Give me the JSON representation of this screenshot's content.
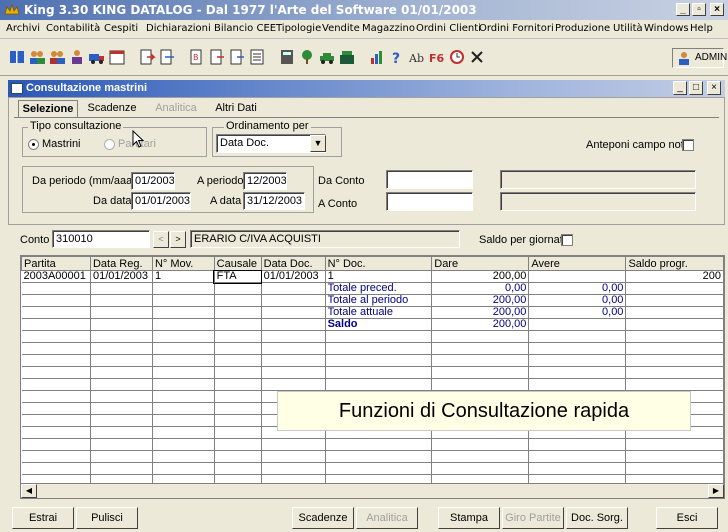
{
  "window": {
    "title": "King 3.30   KING   DATALOG - Dal 1977 l'Arte del Software 01/01/2003"
  },
  "menu": [
    "Archivi",
    "Contabilità",
    "Cespiti",
    "Dichiarazioni",
    "Bilancio CEE",
    "Tipologie",
    "Vendite",
    "Magazzino",
    "Ordini Clienti",
    "Ordini Fornitori",
    "Produzione",
    "Utilità",
    "Windows",
    "Help"
  ],
  "toolbar": {
    "user": "ADMIN"
  },
  "child": {
    "title": "Consultazione mastrini"
  },
  "tabs": [
    "Selezione",
    "Scadenze",
    "Analitica",
    "Altri Dati"
  ],
  "selection": {
    "tipo_legend": "Tipo consultazione",
    "radio_mastrini": "Mastrini",
    "radio_partitari": "Partitari",
    "ordinamento_legend": "Ordinamento per",
    "ordinamento_value": "Data Doc.",
    "anteponi_label": "Anteponi campo note",
    "da_periodo_label": "Da periodo (mm/aaaa)",
    "da_periodo_value": "01/2003",
    "a_periodo_label": "A periodo",
    "a_periodo_value": "12/2003",
    "da_data_label": "Da data",
    "da_data_value": "01/01/2003",
    "a_data_label": "A data",
    "a_data_value": "31/12/2003",
    "da_conto_label": "Da Conto",
    "a_conto_label": "A Conto"
  },
  "conto": {
    "label": "Conto",
    "value": "310010",
    "description": "ERARIO C/IVA ACQUISTI",
    "saldo_giornata_label": "Saldo per giornata"
  },
  "grid": {
    "columns": [
      "Partita",
      "Data Reg.",
      "N° Mov.",
      "Causale",
      "Data Doc.",
      "N° Doc.",
      "Dare",
      "Avere",
      "Saldo progr."
    ],
    "rows": [
      [
        "2003A00001",
        "01/01/2003",
        "1",
        "FTA",
        "01/01/2003",
        "1",
        "200,00",
        "",
        "200"
      ],
      [
        "",
        "",
        "",
        "",
        "",
        "Totale preced.",
        "0,00",
        "0,00",
        ""
      ],
      [
        "",
        "",
        "",
        "",
        "",
        "Totale al periodo",
        "200,00",
        "0,00",
        ""
      ],
      [
        "",
        "",
        "",
        "",
        "",
        "Totale attuale",
        "200,00",
        "0,00",
        ""
      ],
      [
        "",
        "",
        "",
        "",
        "",
        "Saldo",
        "200,00",
        "",
        ""
      ]
    ]
  },
  "overlay_text": "Funzioni di Consultazione rapida",
  "buttons": [
    "Estrai",
    "Pulisci",
    "Scadenze",
    "Analitica",
    "Stampa",
    "Giro Partite",
    "Doc. Sorg.",
    "Esci"
  ]
}
